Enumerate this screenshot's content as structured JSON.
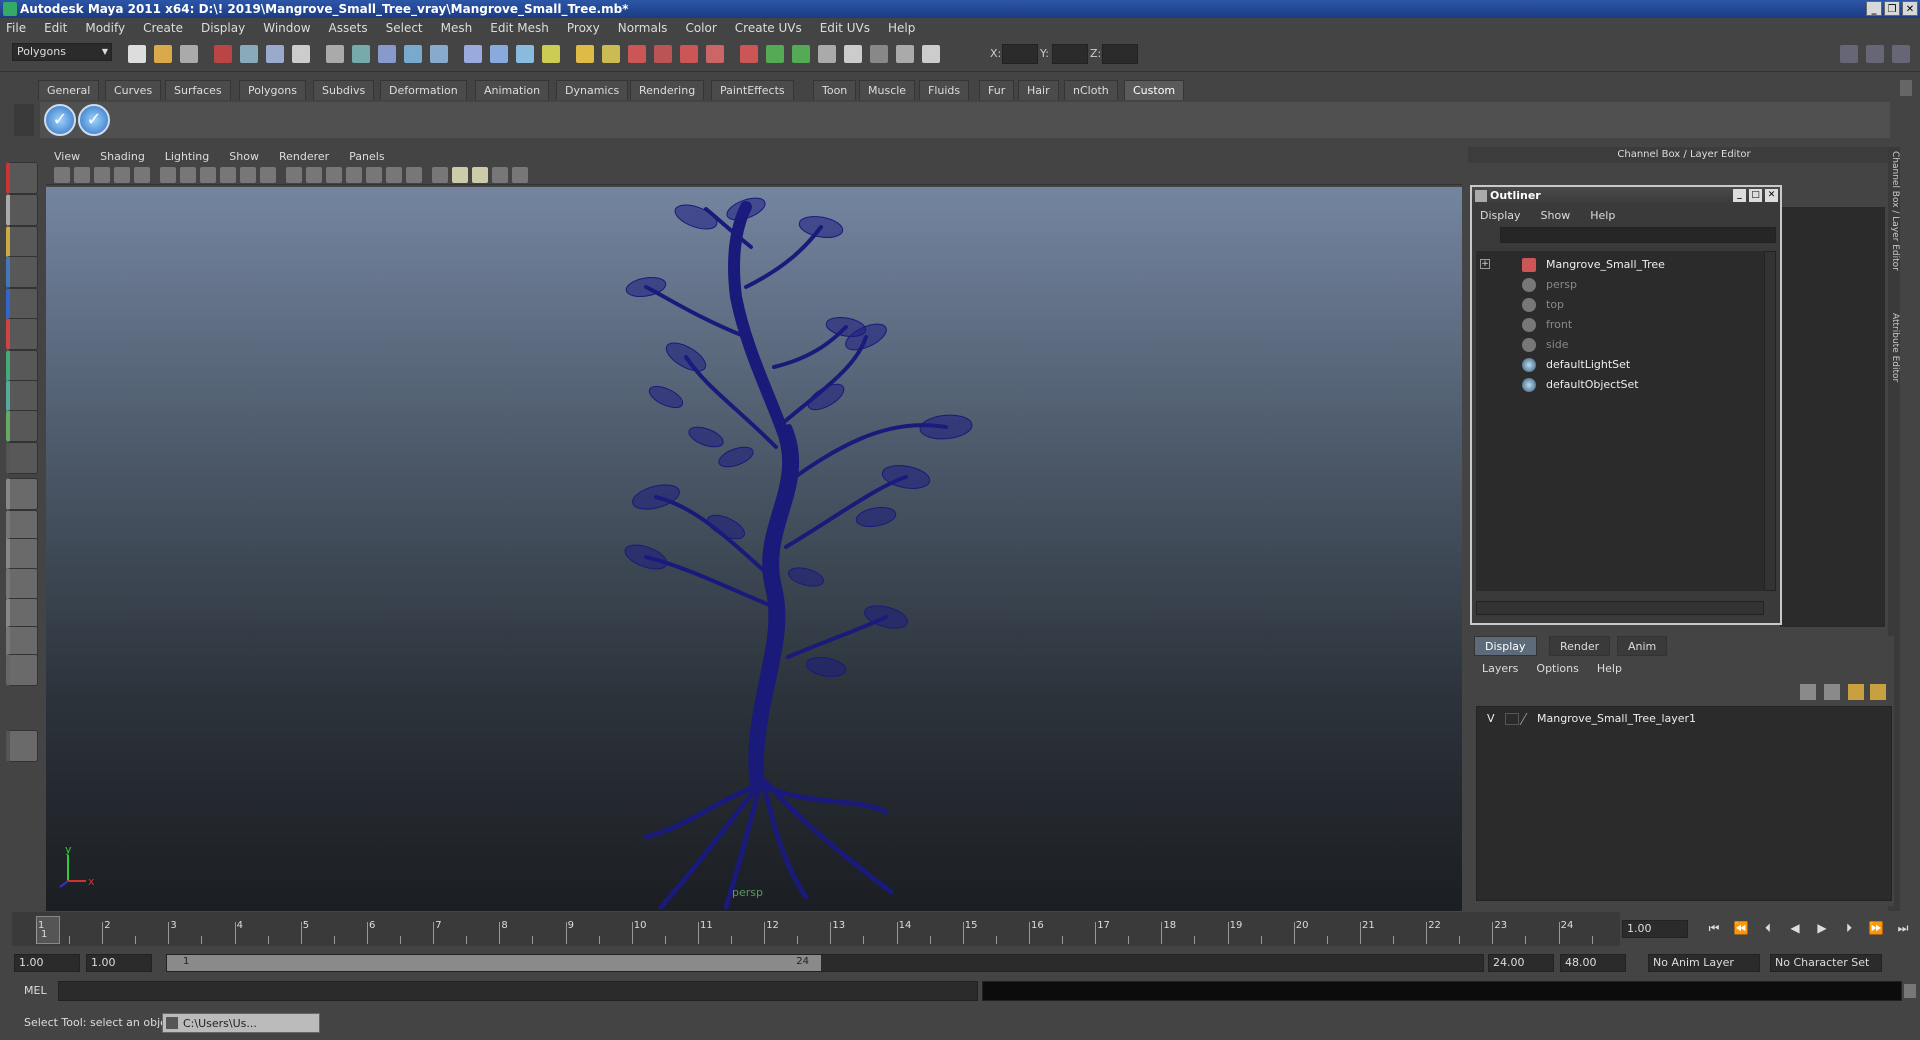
{
  "window": {
    "title": "Autodesk Maya 2011 x64: D:\\! 2019\\Mangrove_Small_Tree_vray\\Mangrove_Small_Tree.mb*"
  },
  "menubar": [
    "File",
    "Edit",
    "Modify",
    "Create",
    "Display",
    "Window",
    "Assets",
    "Select",
    "Mesh",
    "Edit Mesh",
    "Proxy",
    "Normals",
    "Color",
    "Create UVs",
    "Edit UVs",
    "Help"
  ],
  "status": {
    "mode": "Polygons",
    "x_label": "X:",
    "y_label": "Y:",
    "z_label": "Z:"
  },
  "shelf_tabs": [
    "General",
    "Curves",
    "Surfaces",
    "Polygons",
    "Subdivs",
    "Deformation",
    "Animation",
    "Dynamics",
    "Rendering",
    "PaintEffects",
    "Toon",
    "Muscle",
    "Fluids",
    "Fur",
    "Hair",
    "nCloth",
    "Custom"
  ],
  "shelf_active": "Custom",
  "viewport": {
    "menu": [
      "View",
      "Shading",
      "Lighting",
      "Show",
      "Renderer",
      "Panels"
    ],
    "camera": "persp",
    "axis_y": "y",
    "axis_x": "x"
  },
  "right_panel": {
    "title": "Channel Box / Layer Editor",
    "side_tab_1": "Channel Box / Layer Editor",
    "side_tab_2": "Attribute Editor"
  },
  "outliner": {
    "title": "Outliner",
    "menu": [
      "Display",
      "Show",
      "Help"
    ],
    "items": [
      {
        "label": "Mangrove_Small_Tree",
        "style": "bright"
      },
      {
        "label": "persp",
        "style": "dim"
      },
      {
        "label": "top",
        "style": "dim"
      },
      {
        "label": "front",
        "style": "dim"
      },
      {
        "label": "side",
        "style": "dim"
      },
      {
        "label": "defaultLightSet",
        "style": "bright"
      },
      {
        "label": "defaultObjectSet",
        "style": "bright"
      }
    ]
  },
  "layer_editor": {
    "tabs": [
      "Display",
      "Render",
      "Anim"
    ],
    "menu": [
      "Layers",
      "Options",
      "Help"
    ],
    "layer": {
      "visible": "V",
      "name": "Mangrove_Small_Tree_layer1"
    }
  },
  "timeline": {
    "ticks": [
      "1",
      "2",
      "3",
      "4",
      "5",
      "6",
      "7",
      "8",
      "9",
      "10",
      "11",
      "12",
      "13",
      "14",
      "15",
      "16",
      "17",
      "18",
      "19",
      "20",
      "21",
      "22",
      "23",
      "24"
    ],
    "current_frame": "1",
    "current_time_field": "1.00"
  },
  "range": {
    "start": "1.00",
    "playback_start": "1.00",
    "slider_start": "1",
    "slider_end": "24",
    "playback_end": "24.00",
    "end": "48.00",
    "anim_layer": "No Anim Layer",
    "char_set": "No Character Set"
  },
  "cmdline": {
    "label": "MEL"
  },
  "helpline": {
    "text": "Select Tool: select an object",
    "task": "C:\\Users\\Us..."
  }
}
